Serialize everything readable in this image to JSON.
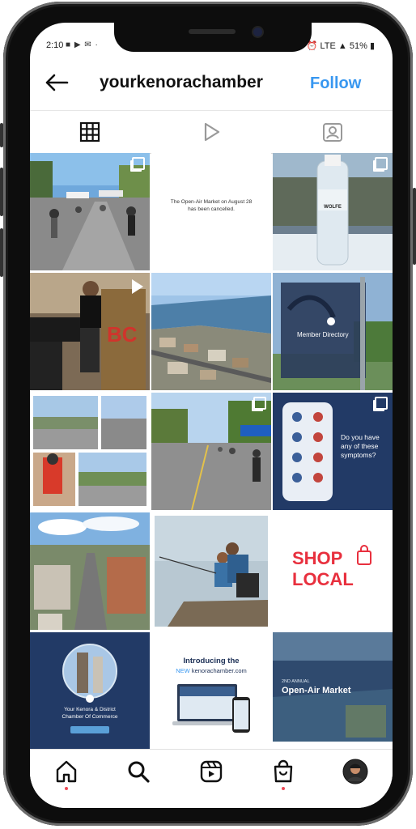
{
  "status_bar": {
    "time": "2:10",
    "battery": "51%",
    "right_icons": "⏰ LTE ▲"
  },
  "header": {
    "username": "yourkenorachamber",
    "follow_label": "Follow"
  },
  "posts": {
    "cancel_text": "The Open-Air Market on August 28 has been cancelled.",
    "bottle_brand": "WOLFE",
    "member_directory": "Member Directory",
    "symptoms_text": "Do you have any of these symptoms?",
    "shop_local_line1": "SHOP",
    "shop_local_line2": "LOCAL",
    "chamber_name_line1": "Your Kenora & District",
    "chamber_name_line2": "Chamber Of Commerce",
    "introducing": "Introducing the",
    "new_word": "NEW",
    "site": "kenorachamber.com",
    "market_small": "2ND ANNUAL",
    "market_title": "Open-Air Market"
  },
  "colors": {
    "follow": "#3897f0",
    "accent_red": "#e8303e",
    "navy": "#213a66"
  }
}
